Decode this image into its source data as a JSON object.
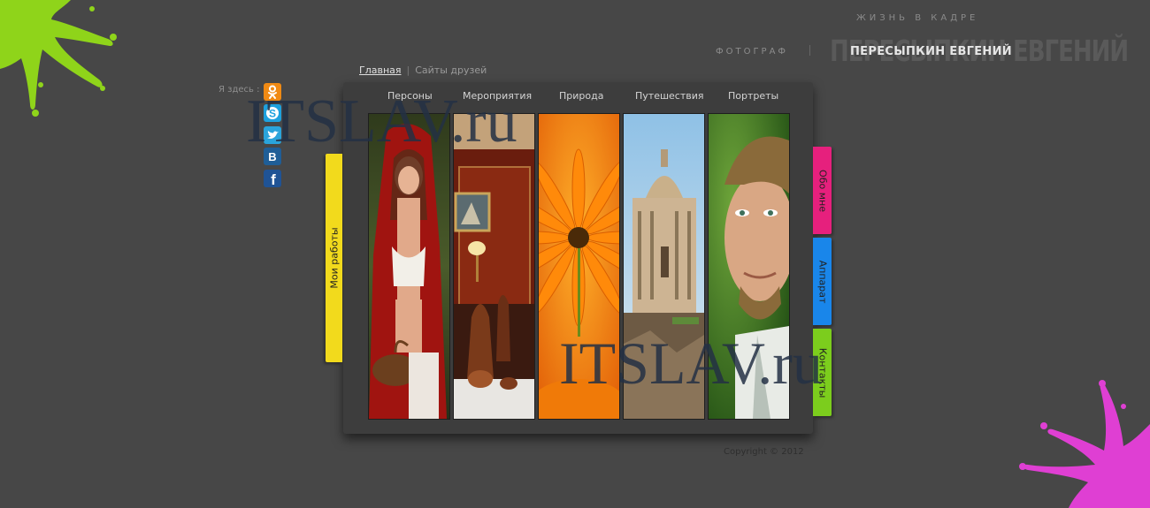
{
  "header": {
    "tagline": "ЖИЗНЬ В КАДРЕ",
    "photographer_label": "ФОТОГРАФ",
    "photographer_name": "ПЕРЕСЫПКИН ЕВГЕНИЙ"
  },
  "topnav": {
    "home": "Главная",
    "separator": "|",
    "friends": "Сайты друзей"
  },
  "social": {
    "label": "Я здесь :",
    "items": [
      {
        "name": "odnoklassniki",
        "glyph": "ok",
        "color": "#f08a13"
      },
      {
        "name": "skype",
        "glyph": "S",
        "color": "#1ea1de"
      },
      {
        "name": "twitter",
        "glyph": "t",
        "color": "#2aa4db"
      },
      {
        "name": "vkontakte",
        "glyph": "B",
        "color": "#1f5e97"
      },
      {
        "name": "facebook",
        "glyph": "f",
        "color": "#1f5395"
      }
    ]
  },
  "categories": [
    "Персоны",
    "Мероприятия",
    "Природа",
    "Путешествия",
    "Портреты"
  ],
  "side_tabs": {
    "left": "Мои работы",
    "right": [
      "Обо мне",
      "Аппарат",
      "Контакты"
    ],
    "colors": {
      "left": "#f2da1c",
      "about": "#e6207d",
      "apparat": "#1986ea",
      "contacts": "#7ccd1d"
    }
  },
  "copyright": "Copyright © 2012",
  "watermark": "ITSLAV.ru"
}
